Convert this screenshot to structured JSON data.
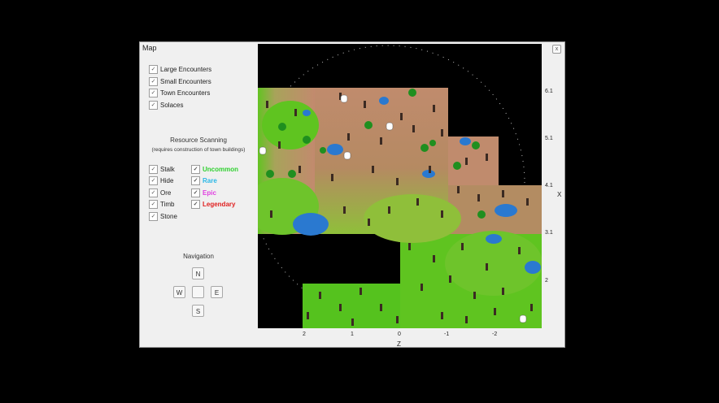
{
  "window": {
    "title": "Map",
    "close_label": "x"
  },
  "encounters": [
    {
      "label": "Large Encounters",
      "checked": true
    },
    {
      "label": "Small Encounters",
      "checked": true
    },
    {
      "label": "Town Encounters",
      "checked": true
    },
    {
      "label": "Solaces",
      "checked": true
    }
  ],
  "resource_scanning": {
    "heading": "Resource Scanning",
    "subheading": "(requires construction of town buildings)",
    "types": [
      {
        "label": "Stalk",
        "checked": true
      },
      {
        "label": "Hide",
        "checked": true
      },
      {
        "label": "Ore",
        "checked": true
      },
      {
        "label": "Timb",
        "checked": true
      },
      {
        "label": "Stone",
        "checked": true
      }
    ],
    "rarities": [
      {
        "label": "Uncommon",
        "checked": true,
        "color": "#2fd02f"
      },
      {
        "label": "Rare",
        "checked": true,
        "color": "#29b7e6"
      },
      {
        "label": "Epic",
        "checked": true,
        "color": "#e040e0"
      },
      {
        "label": "Legendary",
        "checked": true,
        "color": "#e02020"
      }
    ]
  },
  "navigation": {
    "heading": "Navigation",
    "north": "N",
    "west": "W",
    "east": "E",
    "south": "S"
  },
  "axes": {
    "x_name": "X",
    "x_ticks": [
      "6.1",
      "5.1",
      "4.1",
      "3.1",
      "2"
    ],
    "z_name": "Z",
    "z_ticks": [
      "2",
      "1",
      "0",
      "-1",
      "-2"
    ]
  }
}
